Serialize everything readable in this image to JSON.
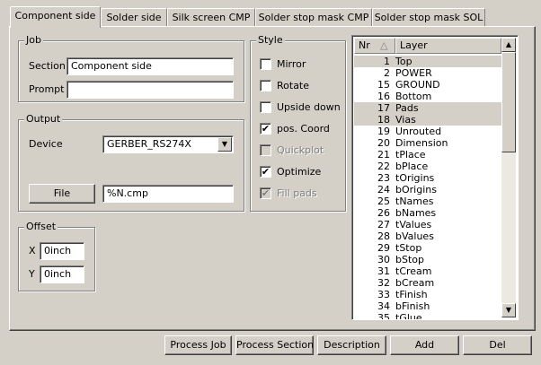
{
  "tabs": [
    {
      "label": "Component side"
    },
    {
      "label": "Solder side"
    },
    {
      "label": "Silk screen CMP"
    },
    {
      "label": "Solder stop mask CMP"
    },
    {
      "label": "Solder stop mask SOL"
    }
  ],
  "job": {
    "title": "Job",
    "section_label": "Section",
    "section_value": "Component side",
    "prompt_label": "Prompt",
    "prompt_value": ""
  },
  "output": {
    "title": "Output",
    "device_label": "Device",
    "device_value": "GERBER_RS274X",
    "file_button": "File",
    "file_value": "%N.cmp"
  },
  "offset": {
    "title": "Offset",
    "x_label": "X",
    "x_value": "0inch",
    "y_label": "Y",
    "y_value": "0inch"
  },
  "style": {
    "title": "Style",
    "options": [
      {
        "label": "Mirror",
        "checked": false,
        "enabled": true
      },
      {
        "label": "Rotate",
        "checked": false,
        "enabled": true
      },
      {
        "label": "Upside down",
        "checked": false,
        "enabled": true
      },
      {
        "label": "pos. Coord",
        "checked": true,
        "enabled": true
      },
      {
        "label": "Quickplot",
        "checked": false,
        "enabled": false
      },
      {
        "label": "Optimize",
        "checked": true,
        "enabled": true
      },
      {
        "label": "Fill pads",
        "checked": true,
        "enabled": false
      }
    ]
  },
  "layers": {
    "col_nr": "Nr",
    "col_layer": "Layer",
    "rows": [
      {
        "nr": "1",
        "name": "Top",
        "selected": true
      },
      {
        "nr": "2",
        "name": "POWER",
        "selected": false
      },
      {
        "nr": "15",
        "name": "GROUND",
        "selected": false
      },
      {
        "nr": "16",
        "name": "Bottom",
        "selected": false
      },
      {
        "nr": "17",
        "name": "Pads",
        "selected": true
      },
      {
        "nr": "18",
        "name": "Vias",
        "selected": true
      },
      {
        "nr": "19",
        "name": "Unrouted",
        "selected": false
      },
      {
        "nr": "20",
        "name": "Dimension",
        "selected": false
      },
      {
        "nr": "21",
        "name": "tPlace",
        "selected": false
      },
      {
        "nr": "22",
        "name": "bPlace",
        "selected": false
      },
      {
        "nr": "23",
        "name": "tOrigins",
        "selected": false
      },
      {
        "nr": "24",
        "name": "bOrigins",
        "selected": false
      },
      {
        "nr": "25",
        "name": "tNames",
        "selected": false
      },
      {
        "nr": "26",
        "name": "bNames",
        "selected": false
      },
      {
        "nr": "27",
        "name": "tValues",
        "selected": false
      },
      {
        "nr": "28",
        "name": "bValues",
        "selected": false
      },
      {
        "nr": "29",
        "name": "tStop",
        "selected": false
      },
      {
        "nr": "30",
        "name": "bStop",
        "selected": false
      },
      {
        "nr": "31",
        "name": "tCream",
        "selected": false
      },
      {
        "nr": "32",
        "name": "bCream",
        "selected": false
      },
      {
        "nr": "33",
        "name": "tFinish",
        "selected": false
      },
      {
        "nr": "34",
        "name": "bFinish",
        "selected": false
      },
      {
        "nr": "35",
        "name": "tGlue",
        "selected": false
      }
    ]
  },
  "bottom_buttons": {
    "process_job": "Process Job",
    "process_section": "Process Section",
    "description": "Description",
    "add": "Add",
    "del": "Del"
  },
  "icons": {
    "checkmark": "✔",
    "dropdown": "▼",
    "scroll_up": "▲",
    "scroll_down": "▼",
    "sort": "△"
  }
}
